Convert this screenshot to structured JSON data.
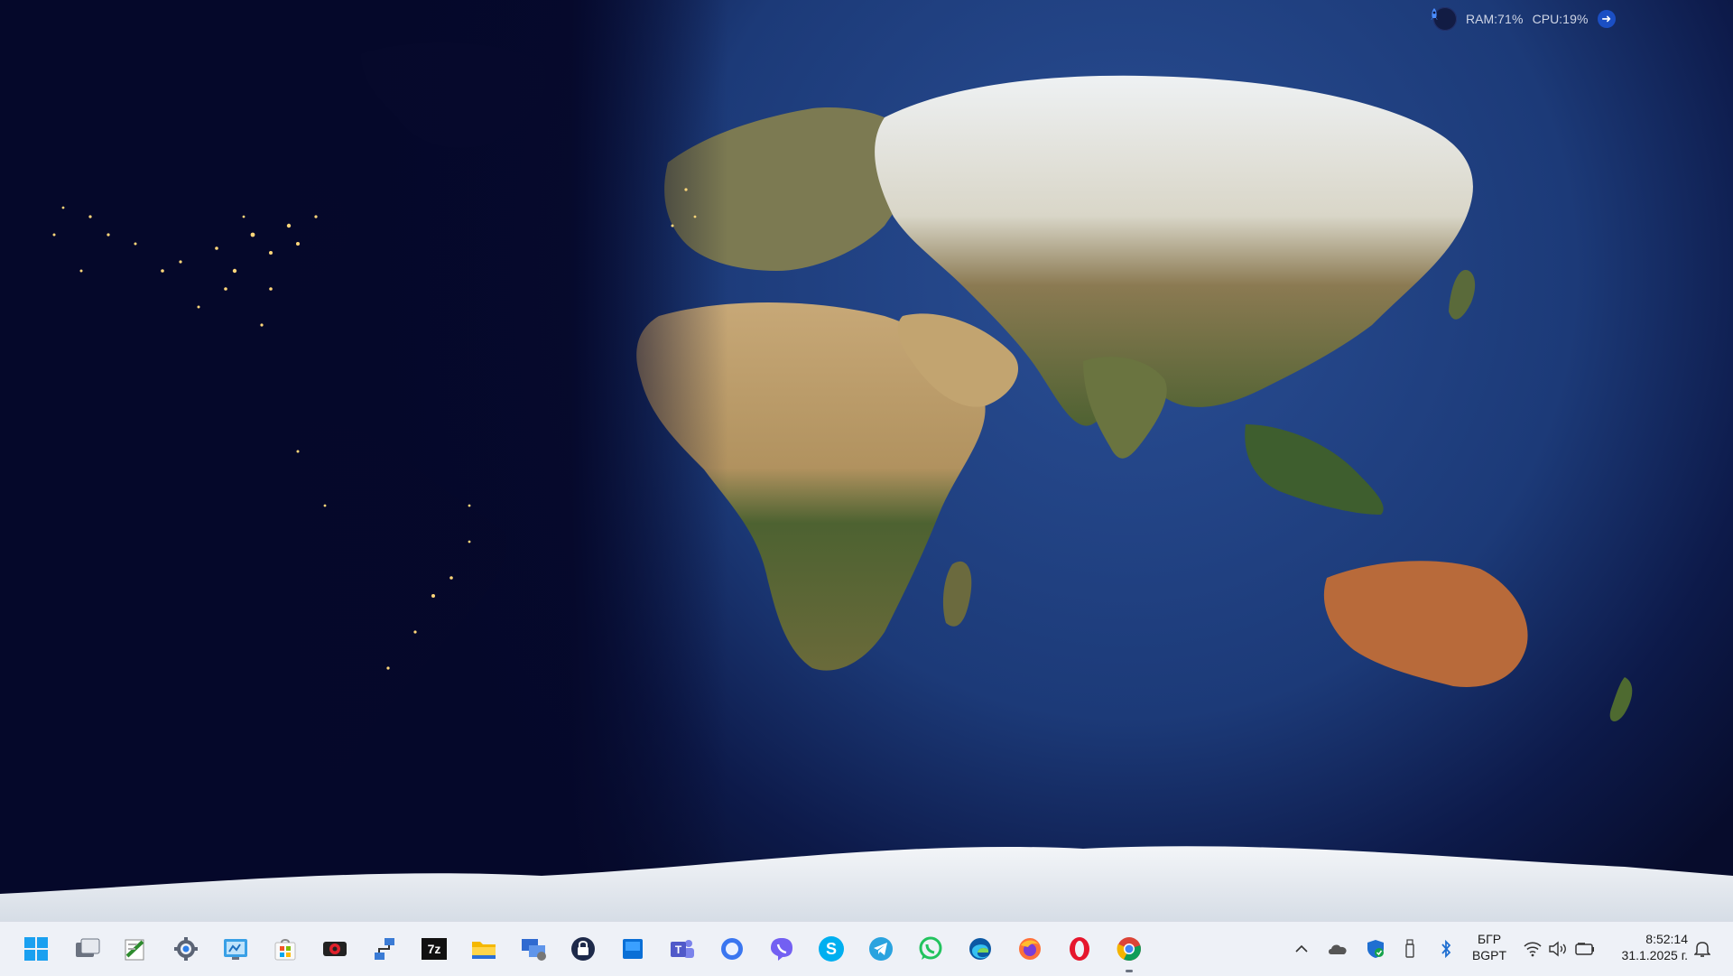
{
  "widget": {
    "ram_label": "RAM:",
    "ram_value": "71%",
    "cpu_label": "CPU:",
    "cpu_value": "19%",
    "rocket_icon": "rocket-icon",
    "arrow_icon": "arrow-right-icon"
  },
  "taskbar": {
    "pinned": [
      {
        "name": "start-button",
        "icon": "windows-logo-icon",
        "running": false
      },
      {
        "name": "task-view",
        "icon": "task-view-icon",
        "running": false
      },
      {
        "name": "app-notepad",
        "icon": "notepad-icon",
        "running": false
      },
      {
        "name": "app-settings",
        "icon": "gear-icon",
        "running": false
      },
      {
        "name": "app-control-panel",
        "icon": "control-panel-icon",
        "running": false
      },
      {
        "name": "app-microsoft-store",
        "icon": "store-icon",
        "running": false
      },
      {
        "name": "app-screen-recorder",
        "icon": "record-icon",
        "running": false
      },
      {
        "name": "app-network",
        "icon": "network-icon",
        "running": false
      },
      {
        "name": "app-7zip",
        "icon": "7zip-icon",
        "label": "7z",
        "running": false
      },
      {
        "name": "app-file-explorer",
        "icon": "folder-icon",
        "running": false
      },
      {
        "name": "app-remote-desktop",
        "icon": "remote-desktop-icon",
        "running": false
      },
      {
        "name": "app-vpn-lock",
        "icon": "lock-icon",
        "running": false
      },
      {
        "name": "app-blue-app",
        "icon": "blue-window-icon",
        "running": false
      },
      {
        "name": "app-teams",
        "icon": "teams-icon",
        "running": false
      },
      {
        "name": "app-signal",
        "icon": "chat-bubble-icon",
        "running": false
      },
      {
        "name": "app-viber",
        "icon": "viber-icon",
        "running": false
      },
      {
        "name": "app-skype",
        "icon": "skype-icon",
        "label": "S",
        "running": false
      },
      {
        "name": "app-telegram",
        "icon": "telegram-icon",
        "running": false
      },
      {
        "name": "app-whatsapp",
        "icon": "whatsapp-icon",
        "running": false
      },
      {
        "name": "app-edge",
        "icon": "edge-icon",
        "running": false
      },
      {
        "name": "app-firefox",
        "icon": "firefox-icon",
        "running": false
      },
      {
        "name": "app-opera",
        "icon": "opera-icon",
        "running": false
      },
      {
        "name": "app-chrome",
        "icon": "chrome-icon",
        "running": true
      }
    ],
    "tray": {
      "language_short": "БГР",
      "language_layout": "BGPT",
      "time": "8:52:14",
      "date": "31.1.2025 г."
    }
  },
  "colors": {
    "taskbar_bg": "#eef1f7",
    "ocean_dark": "#0a1035",
    "ocean_day": "#1f3f80",
    "land_desert": "#b89a6a",
    "land_green": "#4a5e2e",
    "ice": "#e8ecf2",
    "city_lights": "#ffd77a"
  }
}
